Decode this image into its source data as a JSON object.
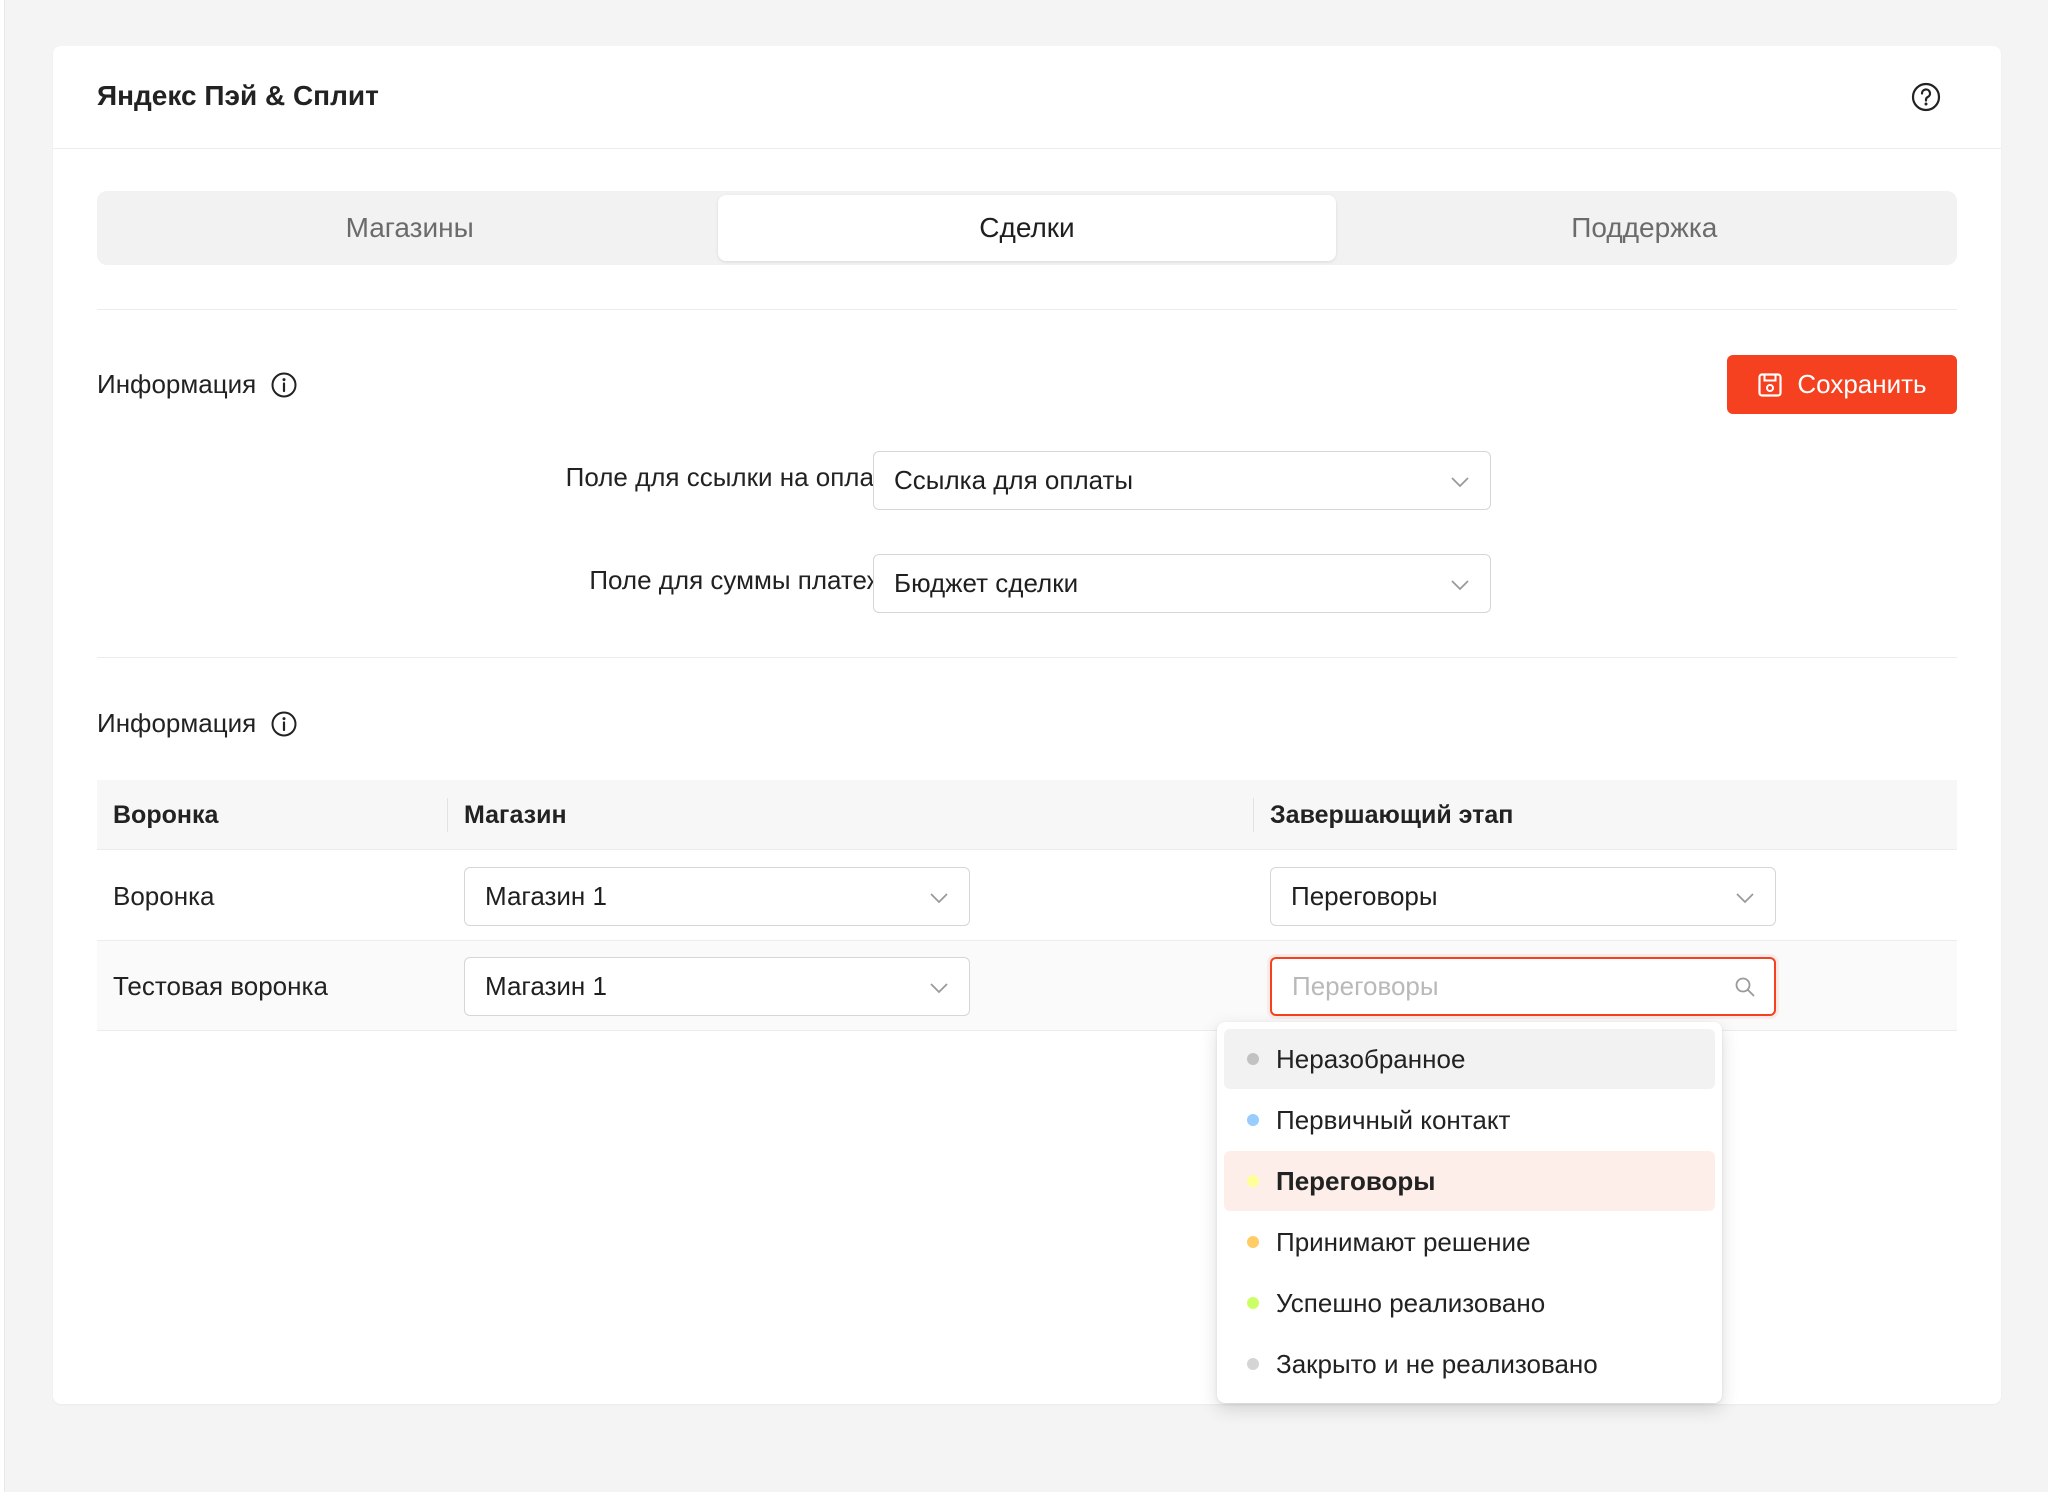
{
  "header": {
    "title": "Яндекс Пэй & Сплит",
    "help_icon": "question-circle-icon"
  },
  "tabs": [
    {
      "label": "Магазины",
      "active": false
    },
    {
      "label": "Сделки",
      "active": true
    },
    {
      "label": "Поддержка",
      "active": false
    }
  ],
  "section1": {
    "title": "Информация",
    "save_label": "Сохранить",
    "fields": [
      {
        "label": "Поле для ссылки на оплату :",
        "value": "Ссылка для оплаты"
      },
      {
        "label": "Поле для суммы платежа :",
        "value": "Бюджет сделки"
      }
    ]
  },
  "section2": {
    "title": "Информация",
    "table": {
      "columns": [
        "Воронка",
        "Магазин",
        "Завершающий этап"
      ],
      "rows": [
        {
          "funnel": "Воронка",
          "store": "Магазин 1",
          "stage": "Переговоры"
        },
        {
          "funnel": "Тестовая воронка",
          "store": "Магазин 1",
          "stage_placeholder": "Переговоры"
        }
      ]
    }
  },
  "dropdown": {
    "options": [
      {
        "label": "Неразобранное",
        "color": "#c2c2c2",
        "state": "hover"
      },
      {
        "label": "Первичный контакт",
        "color": "#99ccff",
        "state": ""
      },
      {
        "label": "Переговоры",
        "color": "#ffff99",
        "state": "selected"
      },
      {
        "label": "Принимают решение",
        "color": "#ffcc66",
        "state": ""
      },
      {
        "label": "Успешно реализовано",
        "color": "#ccff66",
        "state": ""
      },
      {
        "label": "Закрыто и не реализовано",
        "color": "#d5d5d5",
        "state": ""
      }
    ]
  },
  "colors": {
    "accent": "#f5411f"
  }
}
